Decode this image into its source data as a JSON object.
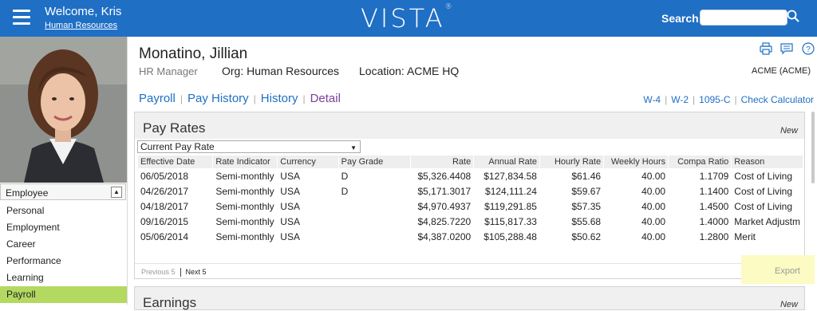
{
  "header": {
    "welcome": "Welcome, Kris",
    "department_link": "Human Resources",
    "logo": "VISTA",
    "search_label": "Search:",
    "search_value": ""
  },
  "sidebar": {
    "section_label": "Employee",
    "items": [
      {
        "label": "Personal"
      },
      {
        "label": "Employment"
      },
      {
        "label": "Career"
      },
      {
        "label": "Performance"
      },
      {
        "label": "Learning"
      },
      {
        "label": "Payroll",
        "active": true
      }
    ]
  },
  "employee": {
    "name": "Monatino, Jillian",
    "title": "HR Manager",
    "org": "Org:  Human Resources",
    "location": "Location:  ACME HQ",
    "company": "ACME (ACME)"
  },
  "tabs": [
    "Payroll",
    "Pay History",
    "History",
    "Detail"
  ],
  "active_tab": "Detail",
  "form_links": [
    "W-4",
    "W-2",
    "1095-C",
    "Check Calculator"
  ],
  "pay_rates": {
    "title": "Pay Rates",
    "new_label": "New",
    "filter_selected": "Current Pay Rate",
    "columns": [
      "Effective Date",
      "Rate Indicator",
      "Currency",
      "Pay Grade",
      "Rate",
      "Annual Rate",
      "Hourly Rate",
      "Weekly Hours",
      "Compa Ratio",
      "Reason"
    ],
    "rows": [
      [
        "06/05/2018",
        "Semi-monthly",
        "USA",
        "D",
        "$5,326.4408",
        "$127,834.58",
        "$61.46",
        "40.00",
        "1.1709",
        "Cost of Living"
      ],
      [
        "04/26/2017",
        "Semi-monthly",
        "USA",
        "D",
        "$5,171.3017",
        "$124,111.24",
        "$59.67",
        "40.00",
        "1.1400",
        "Cost of Living"
      ],
      [
        "04/18/2017",
        "Semi-monthly",
        "USA",
        "",
        "$4,970.4937",
        "$119,291.85",
        "$57.35",
        "40.00",
        "1.4500",
        "Cost of Living"
      ],
      [
        "09/16/2015",
        "Semi-monthly",
        "USA",
        "",
        "$4,825.7220",
        "$115,817.33",
        "$55.68",
        "40.00",
        "1.4000",
        "Market Adjustm"
      ],
      [
        "05/06/2014",
        "Semi-monthly",
        "USA",
        "",
        "$4,387.0200",
        "$105,288.48",
        "$50.62",
        "40.00",
        "1.2800",
        "Merit"
      ]
    ],
    "prev_label": "Previous 5",
    "next_label": "Next 5",
    "export_label": "Export"
  },
  "earnings": {
    "title": "Earnings",
    "new_label": "New"
  },
  "colors": {
    "header_bg": "#1f6fc5",
    "active_nav": "#b3d960",
    "active_tab": "#7a3f98",
    "export_highlight": "#fbfbc3"
  }
}
